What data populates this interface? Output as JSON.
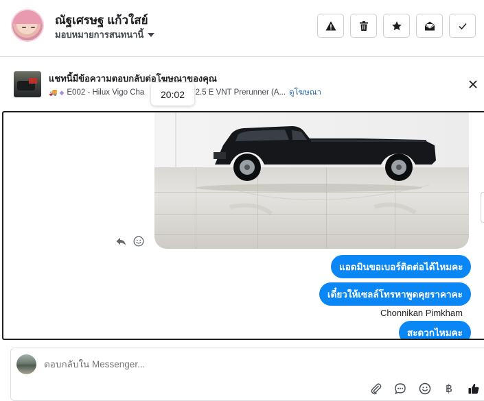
{
  "header": {
    "contact_name": "ณัฐเศรษฐ แก้วใสย์",
    "assign_label": "มอบหมายการสนทนานี้",
    "actions": [
      {
        "name": "report-spam-button",
        "icon": "warning-icon"
      },
      {
        "name": "delete-button",
        "icon": "trash-icon"
      },
      {
        "name": "star-button",
        "icon": "star-icon"
      },
      {
        "name": "mark-unread-button",
        "icon": "envelope-open-icon"
      },
      {
        "name": "mark-done-button",
        "icon": "check-icon"
      }
    ]
  },
  "ad_banner": {
    "title": "แชทนี้มีข้อความตอบกลับต่อโฆษณาของคุณ",
    "ad_text": "E002 - Hilux Vigo Cha",
    "ad_text_tail": "Cab 2.5 E VNT Prerunner (A...",
    "view_ad_link": "ดูโฆษณา",
    "timestamp": "20:02"
  },
  "messages": [
    {
      "type": "image",
      "alt": "black pickup truck"
    },
    {
      "type": "text",
      "text": "แอดมินขอเบอร์ติดต่อได้ไหมคะ"
    },
    {
      "type": "text",
      "text": "เดี๋ยวให้เซลล์โทรหาพูดคุยราคาคะ"
    },
    {
      "type": "sender",
      "text": "Chonnikan Pimkham"
    },
    {
      "type": "text",
      "text": "สะดวกไหมคะ"
    }
  ],
  "composer": {
    "placeholder": "ตอบกลับใน Messenger...",
    "tools": [
      "paperclip-icon",
      "chat-bubble-icon",
      "emoji-icon",
      "baht-icon",
      "thumbs-up-icon"
    ]
  },
  "colors": {
    "bubble": "#0b86f5",
    "link": "#2a6aa8",
    "border": "#dddfe2"
  }
}
